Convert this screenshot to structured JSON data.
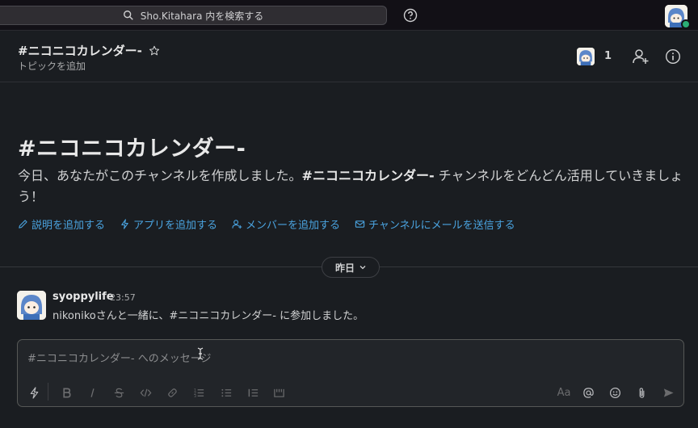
{
  "topbar": {
    "search_placeholder": "Sho.Kitahara 内を検索する"
  },
  "header": {
    "channel_name": "#ニコニコカレンダー-",
    "topic_link": "トピックを追加",
    "member_count": "1"
  },
  "intro": {
    "title": "#ニコニコカレンダー-",
    "text_before": "今日、あなたがこのチャンネルを作成しました。",
    "text_channel": "#ニコニコカレンダー-",
    "text_after": " チャンネルをどんどん活用していきましょう！",
    "actions": [
      {
        "label": "説明を追加する",
        "icon": "pencil-icon"
      },
      {
        "label": "アプリを追加する",
        "icon": "lightning-icon"
      },
      {
        "label": "メンバーを追加する",
        "icon": "add-person-icon"
      },
      {
        "label": "チャンネルにメールを送信する",
        "icon": "email-icon"
      }
    ]
  },
  "divider": {
    "day_label": "昨日"
  },
  "message": {
    "user": "syoppylife",
    "time": "23:57",
    "body": "nikonikoさんと一緒に、#ニコニコカレンダー- に参加しました。"
  },
  "composer": {
    "placeholder": "#ニコニコカレンダー- へのメッセージ",
    "format_label": "Aa"
  },
  "colors": {
    "background": "#1a1d21",
    "topbar": "#121016",
    "link": "#4aa3df",
    "presence": "#2bac76"
  }
}
